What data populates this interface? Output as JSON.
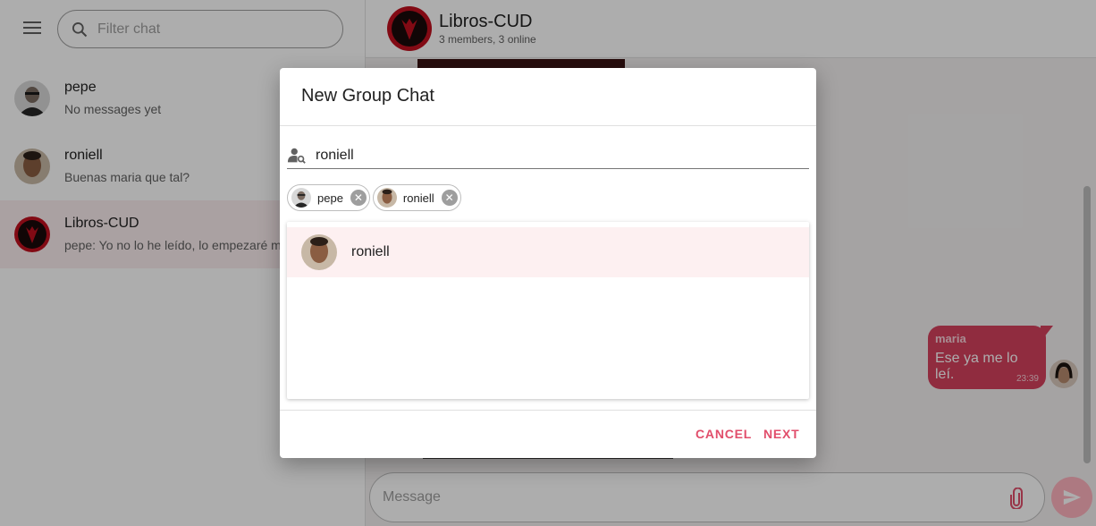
{
  "sidebar": {
    "search_placeholder": "Filter chat",
    "chats": [
      {
        "name": "pepe",
        "last_message": "No messages yet"
      },
      {
        "name": "roniell",
        "last_message": "Buenas maria que tal?"
      },
      {
        "name": "Libros-CUD",
        "last_message": "pepe: Yo no lo he leído, lo empezaré mañana"
      }
    ]
  },
  "header": {
    "title": "Libros-CUD",
    "subtitle": "3 members, 3 online"
  },
  "messages": [
    {
      "author": "maria",
      "text": "Ese ya me lo leí.",
      "time": "23:39"
    }
  ],
  "composer": {
    "placeholder": "Message"
  },
  "dialog": {
    "title": "New Group Chat",
    "search_value": "roniell",
    "selected": [
      {
        "name": "pepe"
      },
      {
        "name": "roniell"
      }
    ],
    "results": [
      {
        "name": "roniell"
      }
    ],
    "cancel_label": "CANCEL",
    "next_label": "NEXT"
  },
  "colors": {
    "accent": "#e14e6b",
    "bubble": "#d4415e",
    "selected_row": "#fdf0f1"
  },
  "icons": [
    "menu-icon",
    "search-icon",
    "user-search-icon",
    "cancel-circle-icon",
    "paperclip-icon",
    "send-icon"
  ]
}
